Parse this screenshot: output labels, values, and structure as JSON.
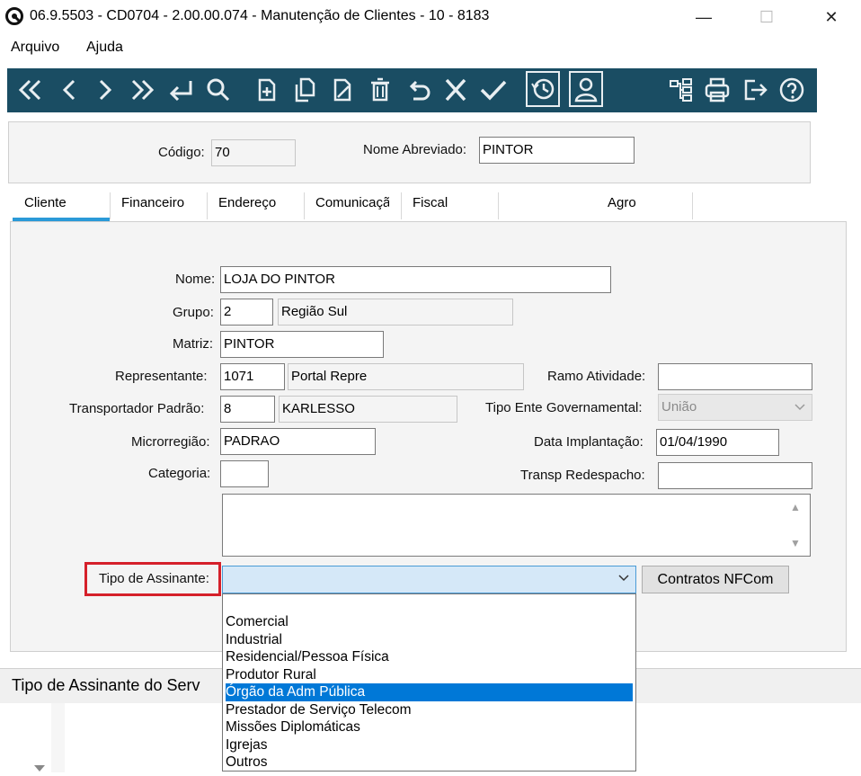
{
  "window": {
    "title": "06.9.5503 - CD0704 - 2.00.00.074 - Manutenção de Clientes - 10 - 8183",
    "minimize": "—",
    "maximize": "☐",
    "close": "✕"
  },
  "menu": [
    "Arquivo",
    "Ajuda"
  ],
  "toolbar": {
    "icons": [
      "first-icon",
      "previous-icon",
      "next-icon",
      "last-icon",
      "goto-icon",
      "search-icon",
      "new-icon",
      "copy-icon",
      "edit-icon",
      "delete-icon",
      "undo-icon",
      "cancel-icon",
      "confirm-icon",
      "history-icon",
      "user-icon",
      "structure-icon",
      "print-icon",
      "exit-icon",
      "help-icon"
    ]
  },
  "header": {
    "codigo_label": "Código:",
    "codigo_value": "70",
    "nome_abreviado_label": "Nome Abreviado:",
    "nome_abreviado_value": "PINTOR"
  },
  "tabs": [
    "Cliente",
    "Financeiro",
    "Endereço",
    "Comunicaçã",
    "Fiscal",
    "Agro"
  ],
  "form": {
    "nome_label": "Nome:",
    "nome_value": "LOJA DO PINTOR",
    "grupo_label": "Grupo:",
    "grupo_code": "2",
    "grupo_desc": "Região Sul",
    "matriz_label": "Matriz:",
    "matriz_value": "PINTOR",
    "representante_label": "Representante:",
    "representante_code": "1071",
    "representante_desc": "Portal Repre",
    "ramo_atividade_label": "Ramo Atividade:",
    "ramo_atividade_value": "",
    "transportador_label": "Transportador Padrão:",
    "transportador_code": "8",
    "transportador_desc": "KARLESSO",
    "tipo_ente_label": "Tipo Ente Governamental:",
    "tipo_ente_value": "União",
    "microrregiao_label": "Microrregião:",
    "microrregiao_value": "PADRAO",
    "data_implantacao_label": "Data Implantação:",
    "data_implantacao_value": "01/04/1990",
    "categoria_label": "Categoria:",
    "categoria_value": "",
    "transp_redespacho_label": "Transp Redespacho:",
    "transp_redespacho_value": "",
    "tipo_assinante_label": "Tipo de Assinante:",
    "tipo_assinante_value": "",
    "contratos_button": "Contratos NFCom"
  },
  "dropdown": {
    "options": [
      "Comercial",
      "Industrial",
      "Residencial/Pessoa Física",
      "Produtor Rural",
      "Órgão da Adm Pública",
      "Prestador de Serviço Telecom",
      "Missões Diplomáticas",
      "Igrejas",
      "Outros"
    ],
    "selected": "Órgão da Adm Pública"
  },
  "status_bar": {
    "text": "Tipo de Assinante do Serv"
  },
  "colors": {
    "toolbar": "#1a4d63",
    "tab_accent": "#2a9ad8",
    "highlight": "#d5202a",
    "selection": "#0078d7"
  }
}
